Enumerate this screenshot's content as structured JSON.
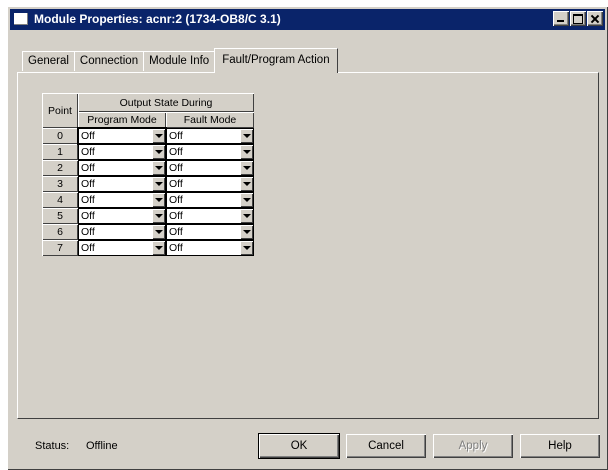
{
  "window": {
    "title": "Module Properties: acnr:2 (1734-OB8/C 3.1)"
  },
  "tabs": [
    {
      "label": "General",
      "active": false
    },
    {
      "label": "Connection",
      "active": false
    },
    {
      "label": "Module Info",
      "active": false
    },
    {
      "label": "Fault/Program Action",
      "active": true
    }
  ],
  "table": {
    "point_header": "Point",
    "group_header": "Output State During",
    "program_header": "Program Mode",
    "fault_header": "Fault Mode",
    "rows": [
      {
        "point": "0",
        "program": "Off",
        "fault": "Off"
      },
      {
        "point": "1",
        "program": "Off",
        "fault": "Off"
      },
      {
        "point": "2",
        "program": "Off",
        "fault": "Off"
      },
      {
        "point": "3",
        "program": "Off",
        "fault": "Off"
      },
      {
        "point": "4",
        "program": "Off",
        "fault": "Off"
      },
      {
        "point": "5",
        "program": "Off",
        "fault": "Off"
      },
      {
        "point": "6",
        "program": "Off",
        "fault": "Off"
      },
      {
        "point": "7",
        "program": "Off",
        "fault": "Off"
      }
    ]
  },
  "status": {
    "label": "Status:",
    "value": "Offline"
  },
  "buttons": {
    "ok": "OK",
    "cancel": "Cancel",
    "apply": "Apply",
    "help": "Help"
  }
}
